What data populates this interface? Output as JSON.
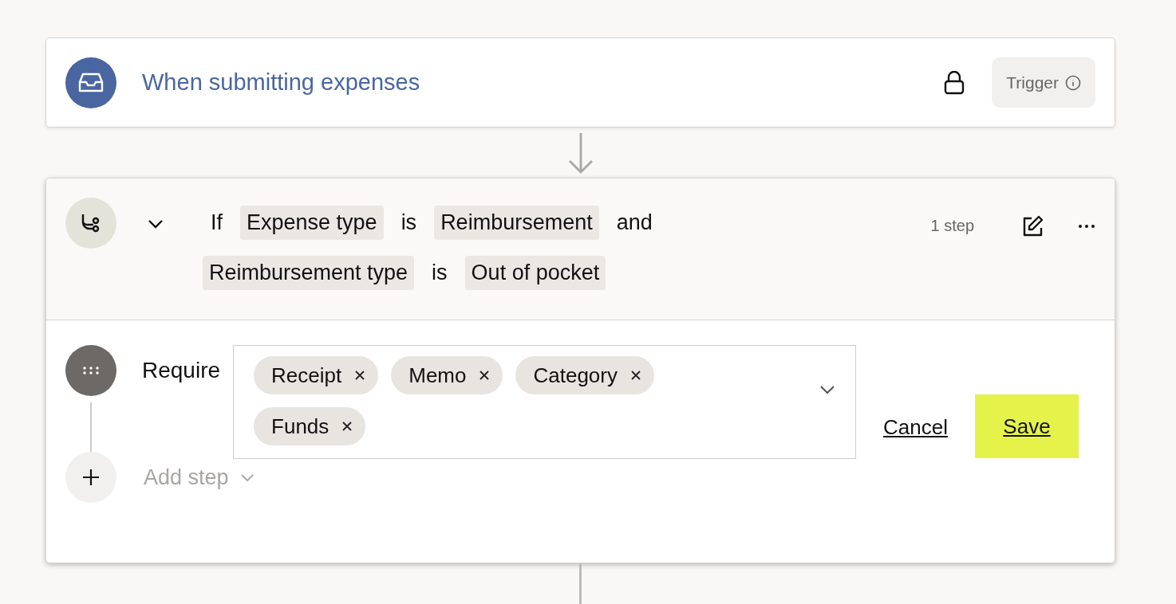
{
  "trigger": {
    "title": "When submitting expenses",
    "locked": true,
    "badge": "Trigger"
  },
  "condition": {
    "expanded": true,
    "step_count": "1 step",
    "parts": [
      {
        "kind": "word",
        "text": "If"
      },
      {
        "kind": "token",
        "text": "Expense type"
      },
      {
        "kind": "word",
        "text": "is"
      },
      {
        "kind": "token",
        "text": "Reimbursement"
      },
      {
        "kind": "word",
        "text": "and"
      },
      {
        "kind": "token",
        "text": "Reimbursement type"
      },
      {
        "kind": "word",
        "text": "is"
      },
      {
        "kind": "token",
        "text": "Out of pocket"
      }
    ]
  },
  "step": {
    "label": "Require",
    "chips": [
      "Receipt",
      "Memo",
      "Category",
      "Funds"
    ],
    "cancel": "Cancel",
    "save": "Save"
  },
  "add_step": "Add step"
}
